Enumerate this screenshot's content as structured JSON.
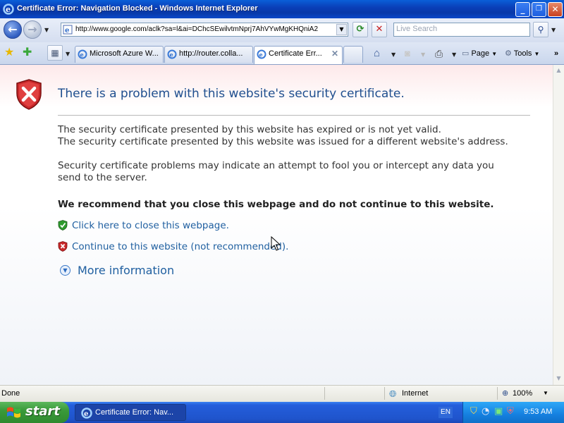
{
  "window": {
    "title": "Certificate Error: Navigation Blocked - Windows Internet Explorer",
    "minimize_glyph": "_",
    "restore_glyph": "❐",
    "close_glyph": "✕"
  },
  "address_bar": {
    "url": "http://www.google.com/aclk?sa=l&ai=DChcSEwilvtmNprj7AhVYwMgKHQniA2",
    "search_placeholder": "Live Search"
  },
  "tabs": [
    {
      "label": "Microsoft Azure W...",
      "active": false
    },
    {
      "label": "http://router.colla...",
      "active": false
    },
    {
      "label": "Certificate Err...",
      "active": true
    }
  ],
  "toolbar": {
    "page_label": "Page",
    "tools_label": "Tools"
  },
  "content": {
    "heading": "There is a problem with this website's security certificate.",
    "reason_1": "The security certificate presented by this website has expired or is not yet valid.",
    "reason_2": "The security certificate presented by this website was issued for a different website's address.",
    "warning_1": "Security certificate problems may indicate an attempt to fool you or intercept any data you",
    "warning_2": "send to the server.",
    "recommendation": "We recommend that you close this webpage and do not continue to this website.",
    "close_link": "Click here to close this webpage.",
    "continue_link": "Continue to this website (not recommended).",
    "more_info": "More information"
  },
  "status_bar": {
    "status": "Done",
    "zone": "Internet",
    "zoom": "100%"
  },
  "taskbar": {
    "start_label": "start",
    "task_label": "Certificate Error: Nav...",
    "language": "EN",
    "clock": "9:53 AM"
  },
  "colors": {
    "heading": "#1f4f8f",
    "link": "#1f5fa0",
    "shield_red": "#c8282a",
    "titlebar_blue": "#0a3fb8"
  }
}
